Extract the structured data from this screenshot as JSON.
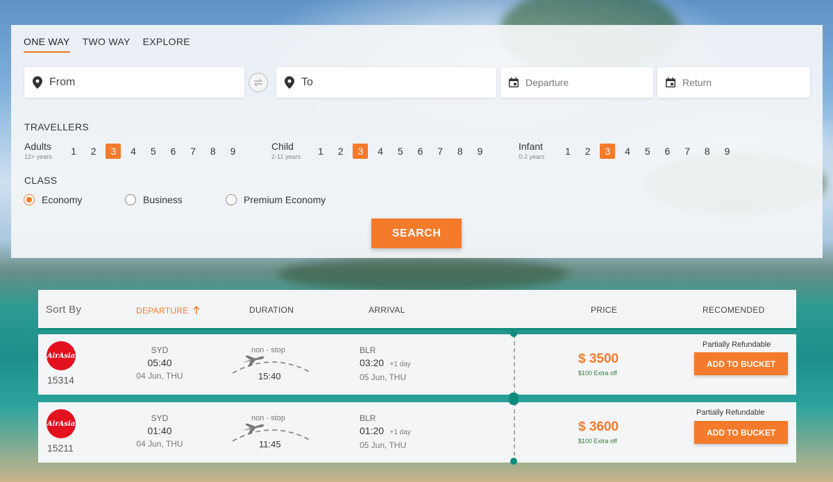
{
  "tabs": [
    {
      "label": "ONE WAY"
    },
    {
      "label": "TWO WAY"
    },
    {
      "label": "EXPLORE"
    }
  ],
  "search": {
    "from_placeholder": "From",
    "to_placeholder": "To",
    "departure_placeholder": "Departure",
    "return_placeholder": "Return",
    "button": "SEARCH"
  },
  "travellers": {
    "title": "TRAVELLERS",
    "groups": [
      {
        "name": "Adults",
        "sub": "12+ years",
        "selected": "3"
      },
      {
        "name": "Child",
        "sub": "2-11 years",
        "selected": "3"
      },
      {
        "name": "Infant",
        "sub": "0-2 years",
        "selected": "3"
      }
    ],
    "numbers": [
      "1",
      "2",
      "3",
      "4",
      "5",
      "6",
      "7",
      "8",
      "9"
    ]
  },
  "class": {
    "title": "CLASS",
    "options": [
      {
        "label": "Economy",
        "selected": true
      },
      {
        "label": "Business",
        "selected": false
      },
      {
        "label": "Premium Economy",
        "selected": false
      }
    ]
  },
  "sort": {
    "label": "Sort By",
    "departure": "DEPARTURE",
    "duration": "DURATION",
    "arrival": "ARRIVAL",
    "price": "PRICE",
    "recommended": "RECOMENDED"
  },
  "results": [
    {
      "airline_logo": "AirAsia",
      "flight_no": "15314",
      "from": "SYD",
      "dep_time": "05:40",
      "dep_date": "04 Jun, THU",
      "stops": "non - stop",
      "duration": "15:40",
      "to": "BLR",
      "arr_time": "03:20",
      "arr_plus": "+1 day",
      "arr_date": "05 Jun, THU",
      "price": "$ 3500",
      "extra": "$100 Extra off",
      "refund": "Partially Refundable",
      "button": "ADD TO BUCKET"
    },
    {
      "airline_logo": "AirAsia",
      "flight_no": "15211",
      "from": "SYD",
      "dep_time": "01:40",
      "dep_date": "04 Jun, THU",
      "stops": "non - stop",
      "duration": "11:45",
      "to": "BLR",
      "arr_time": "01:20",
      "arr_plus": "+1 day",
      "arr_date": "05 Jun, THU",
      "price": "$ 3600",
      "extra": "$100 Extra off",
      "refund": "Partially Refundable",
      "button": "ADD TO BUCKET"
    }
  ],
  "colors": {
    "accent": "#f47a2c",
    "teal": "#0f8c7c"
  },
  "icons": [
    "location-pin-icon",
    "swap-icon",
    "calendar-icon",
    "arrow-up-icon",
    "airplane-icon"
  ]
}
